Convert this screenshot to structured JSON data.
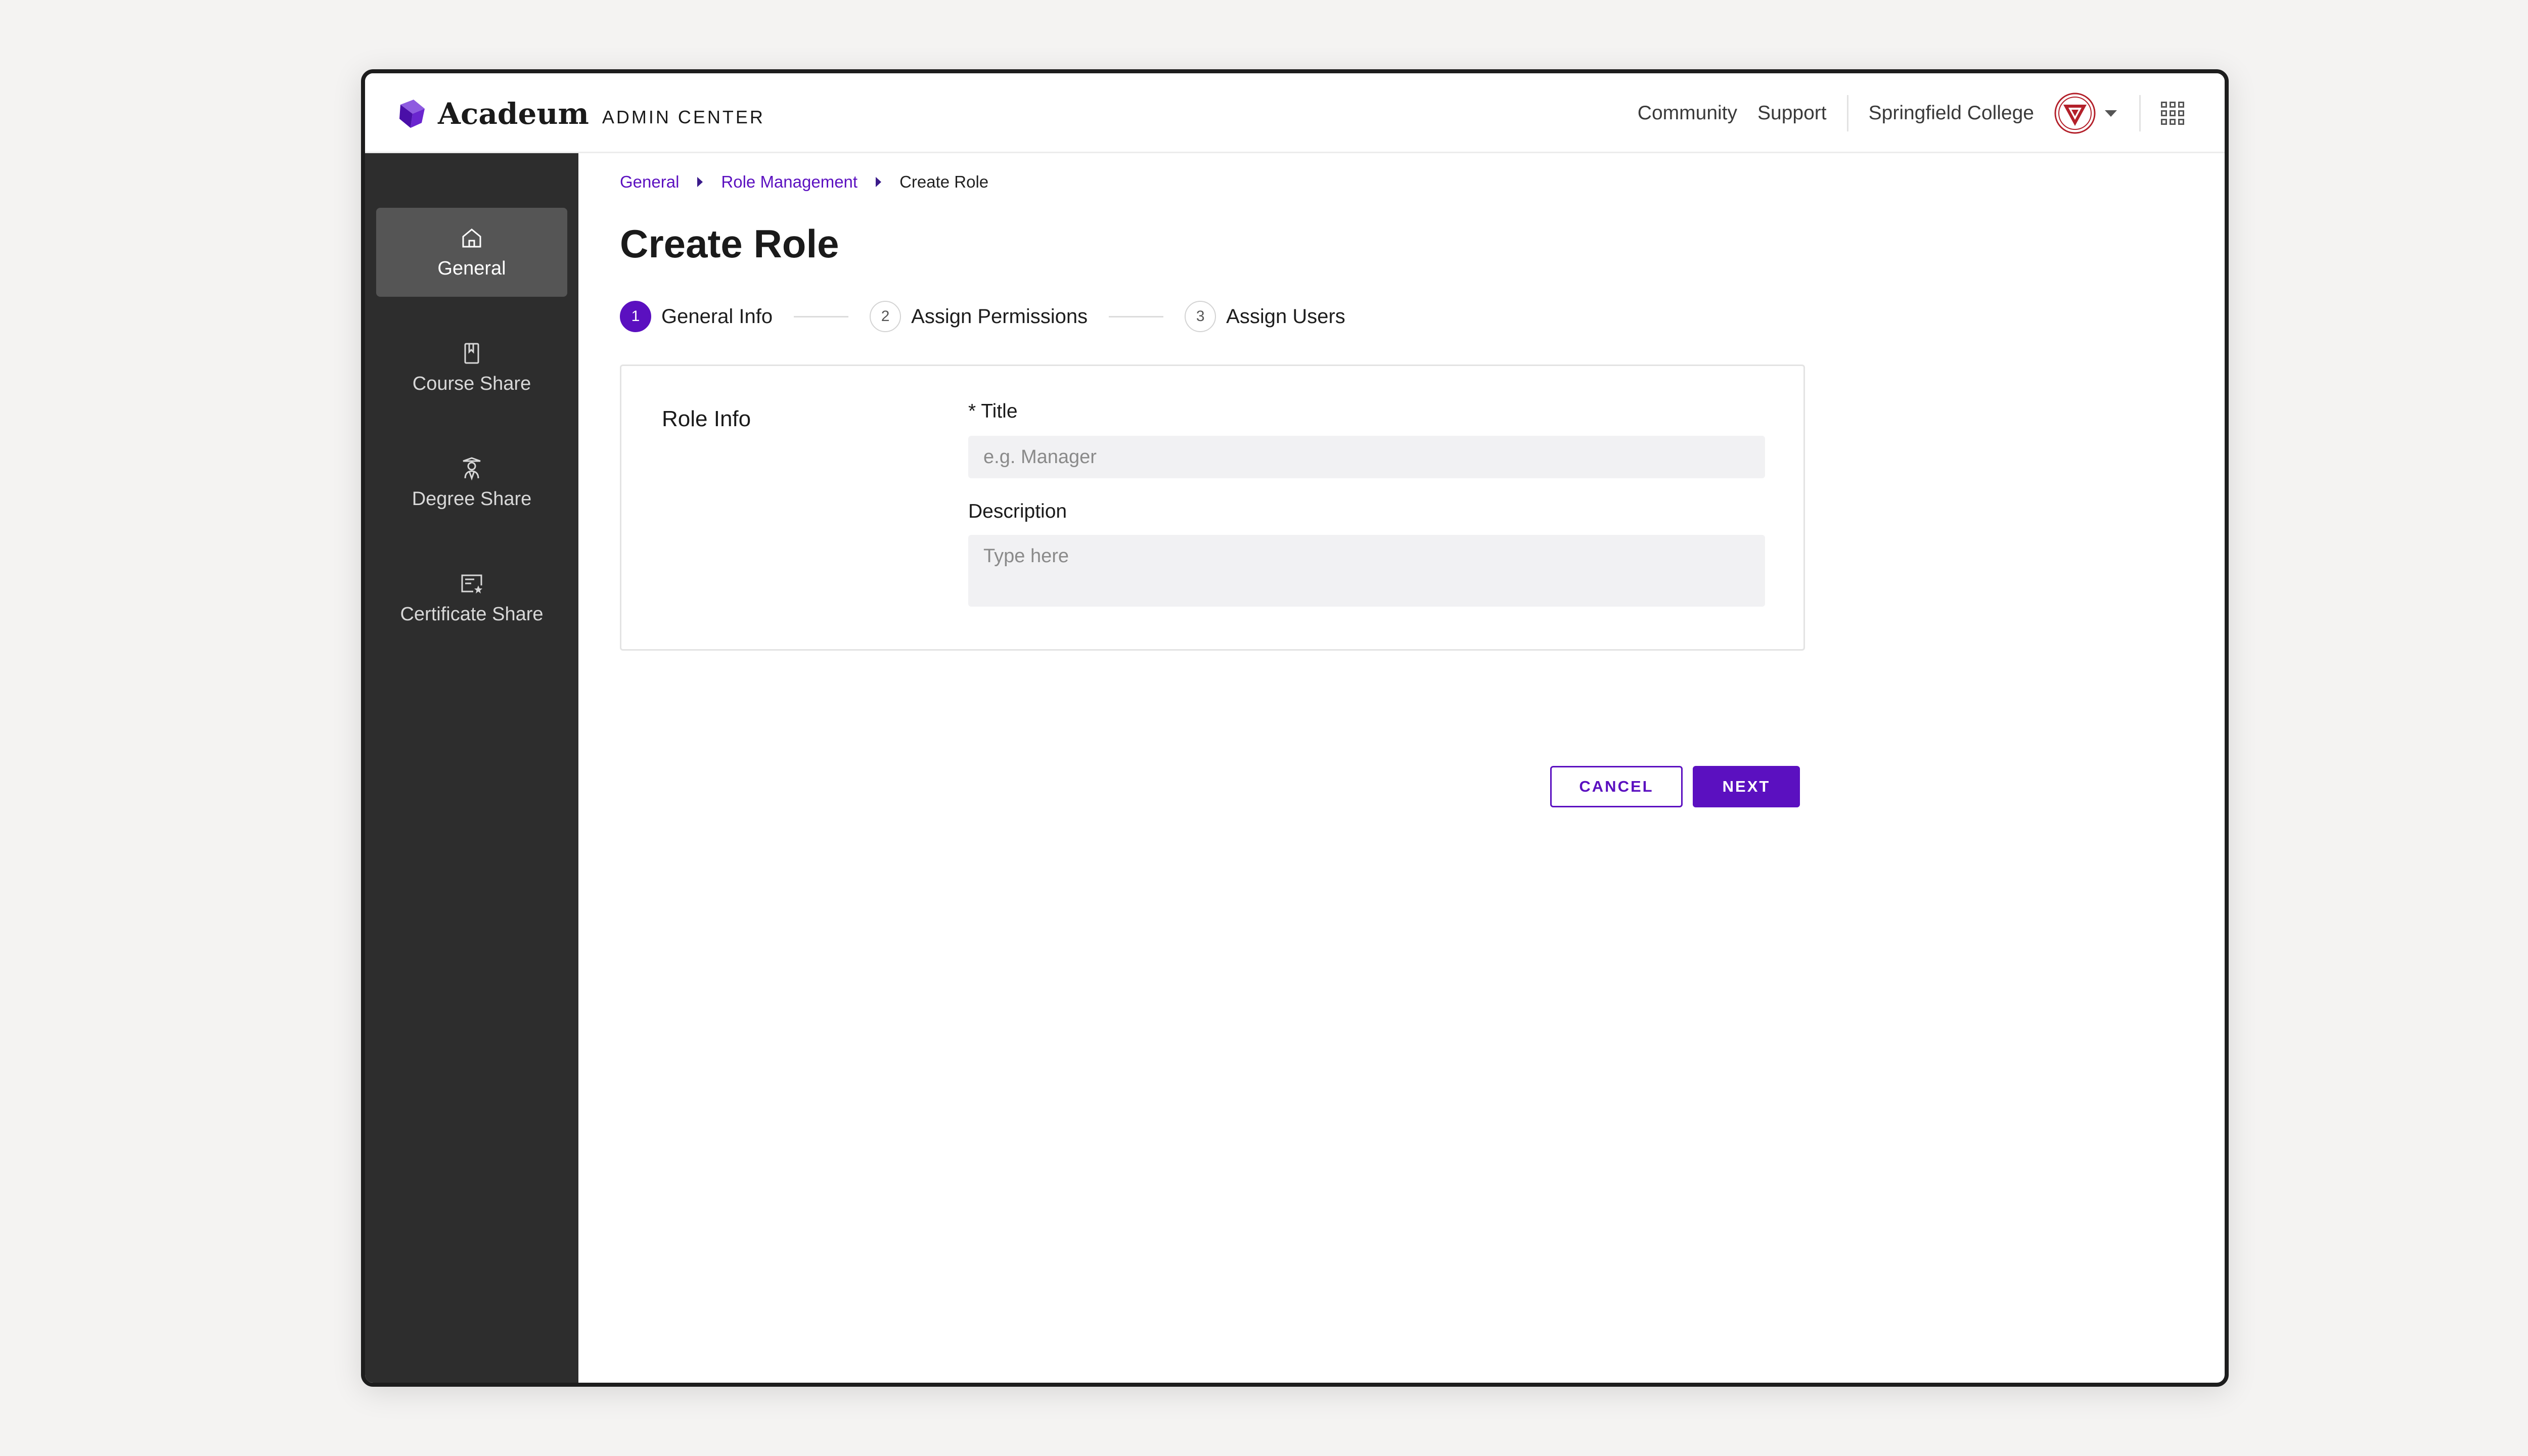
{
  "brand": {
    "name": "Acadeum",
    "subtitle": "ADMIN CENTER",
    "accent_color": "#5b10c0"
  },
  "header": {
    "links": [
      "Community",
      "Support"
    ],
    "institution": "Springfield College",
    "icons": [
      "college-seal-icon",
      "chevron-down-icon",
      "apps-grid-icon"
    ]
  },
  "sidebar": {
    "items": [
      {
        "label": "General",
        "icon": "home-icon",
        "active": true
      },
      {
        "label": "Course Share",
        "icon": "book-icon",
        "active": false
      },
      {
        "label": "Degree Share",
        "icon": "graduate-icon",
        "active": false
      },
      {
        "label": "Certificate Share",
        "icon": "certificate-icon",
        "active": false
      }
    ]
  },
  "breadcrumb": {
    "items": [
      "General",
      "Role Management"
    ],
    "current": "Create Role"
  },
  "page": {
    "title": "Create Role"
  },
  "steps": [
    {
      "number": "1",
      "label": "General Info",
      "active": true
    },
    {
      "number": "2",
      "label": "Assign Permissions",
      "active": false
    },
    {
      "number": "3",
      "label": "Assign Users",
      "active": false
    }
  ],
  "form": {
    "section_title": "Role Info",
    "title_label": "* Title",
    "title_placeholder": "e.g. Manager",
    "title_value": "",
    "description_label": "Description",
    "description_placeholder": "Type here",
    "description_value": ""
  },
  "actions": {
    "cancel_label": "CANCEL",
    "next_label": "NEXT"
  }
}
